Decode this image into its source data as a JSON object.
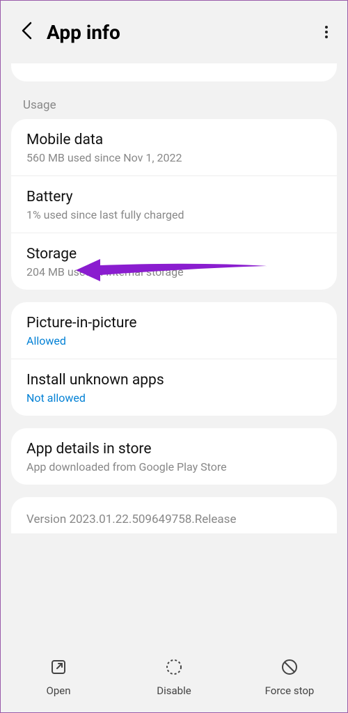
{
  "header": {
    "title": "App info"
  },
  "section": {
    "usage_label": "Usage"
  },
  "usage": {
    "mobile_data": {
      "title": "Mobile data",
      "sub": "560 MB used since Nov 1, 2022"
    },
    "battery": {
      "title": "Battery",
      "sub": "1% used since last fully charged"
    },
    "storage": {
      "title": "Storage",
      "sub": "204 MB used in Internal storage"
    }
  },
  "settings": {
    "pip": {
      "title": "Picture-in-picture",
      "status": "Allowed"
    },
    "unknown_apps": {
      "title": "Install unknown apps",
      "status": "Not allowed"
    }
  },
  "details": {
    "title": "App details in store",
    "sub": "App downloaded from Google Play Store"
  },
  "version": "Version 2023.01.22.509649758.Release",
  "bottom": {
    "open": "Open",
    "disable": "Disable",
    "force_stop": "Force stop"
  },
  "colors": {
    "accent": "#0381d5",
    "arrow": "#8a1dcf"
  }
}
